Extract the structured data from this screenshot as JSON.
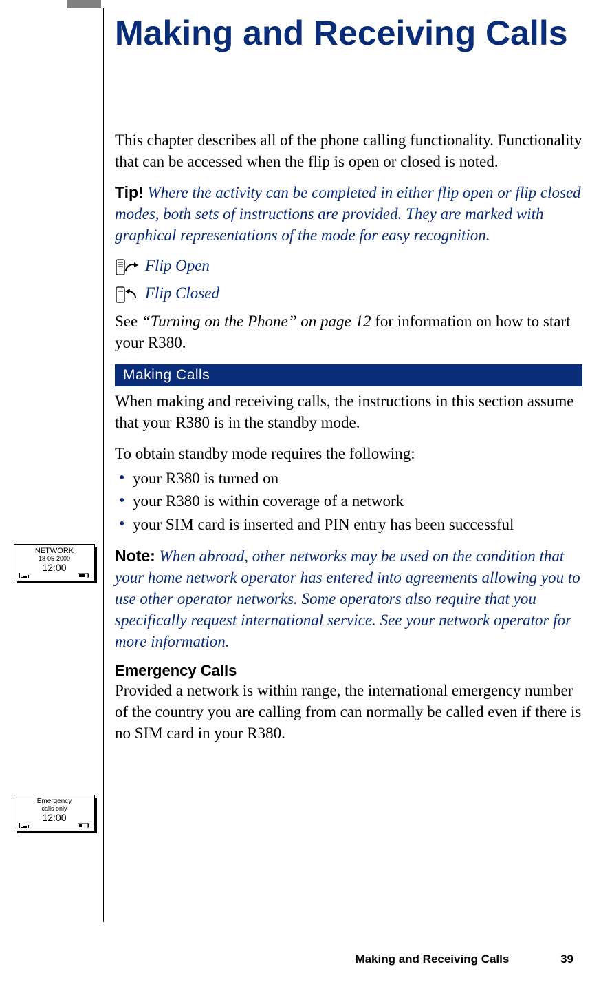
{
  "title": "Making and Receiving Calls",
  "intro": "This chapter describes all of the phone calling functionality. Functionality that can be accessed when the flip is open or closed is noted.",
  "tip": {
    "lead": "Tip!",
    "body": "Where the activity can be completed in either flip open or flip closed modes, both sets of instructions are provided. They are marked with graphical representations of the mode for easy recognition."
  },
  "flip_open_label": "Flip Open",
  "flip_closed_label": "Flip Closed",
  "see_ref": {
    "pre": "See ",
    "ref": "“Turning on the Phone” on page 12",
    "post": " for information on how to start your R380."
  },
  "section1": {
    "heading": "Making Calls",
    "para1": "When making and receiving calls, the instructions in this section assume that your R380 is in the standby mode.",
    "para2": "To obtain standby mode requires the following:",
    "bullets": [
      "your R380 is turned on",
      "your R380 is within coverage of a network",
      "your SIM card is inserted and PIN entry has been successful"
    ]
  },
  "note": {
    "lead": "Note:",
    "body": "When abroad, other networks may be used on the condition that your home network operator has entered into agreements allowing you to use other operator networks. Some operators also require that you specifically request international service. See your network operator for more information."
  },
  "emergency": {
    "heading": "Emergency Calls",
    "body": "Provided a network is within range, the international emergency number of the country you are calling from can normally be called even if there is no SIM card in your R380."
  },
  "screen1": {
    "line1": "NETWORK",
    "line2": "18-05-2000",
    "time": "12:00"
  },
  "screen2": {
    "line1": "Emergency",
    "line2": "calls only",
    "time": "12:00"
  },
  "footer": {
    "title": "Making and Receiving Calls",
    "page": "39"
  }
}
